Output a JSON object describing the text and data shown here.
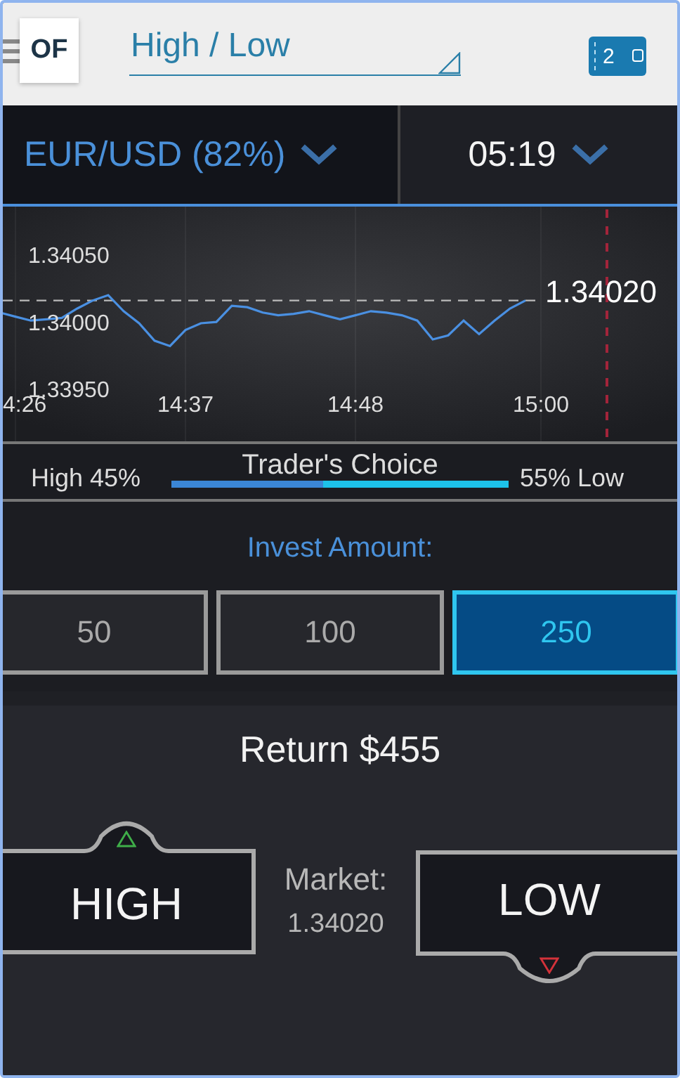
{
  "header": {
    "logo": "OF",
    "title": "High / Low",
    "wallet_count": "2"
  },
  "asset_selector": {
    "label": "EUR/USD (82%)"
  },
  "expiry_selector": {
    "label": "05:19"
  },
  "chart": {
    "chart_data": {
      "type": "line",
      "categories": [
        null,
        "4:26",
        null,
        null,
        null,
        null,
        null,
        null,
        null,
        null,
        null,
        null,
        "14:37",
        null,
        null,
        null,
        null,
        null,
        null,
        null,
        null,
        null,
        null,
        "14:48",
        null,
        null,
        null,
        null,
        null,
        null,
        null,
        null,
        null,
        null,
        null,
        "15:00",
        null,
        null,
        null,
        null,
        null,
        null,
        null,
        null,
        null
      ],
      "series": [
        {
          "color": "#4a90e2",
          "values": [
            1.34011,
            1.34008,
            1.34005,
            1.34006,
            1.34007,
            1.34014,
            1.3402,
            1.34024,
            1.34012,
            1.34003,
            1.3399,
            1.33986,
            1.33998,
            1.34003,
            1.34004,
            1.34016,
            1.34015,
            1.34011,
            1.34009,
            1.3401,
            1.34012,
            1.34009,
            1.34006,
            1.34009,
            1.34012,
            1.34011,
            1.34009,
            1.34005,
            1.33991,
            1.33994,
            1.34005,
            1.33995,
            1.34005,
            1.34014,
            1.3402,
            null,
            null,
            null,
            null,
            null,
            null,
            null,
            null,
            null,
            null
          ]
        }
      ],
      "ylim": [
        1.33915,
        1.3409
      ],
      "yticks": [
        {
          "value": 1.3405,
          "label": "1.34050"
        },
        {
          "value": 1.34,
          "label": "1.34000"
        },
        {
          "value": 1.3395,
          "label": "1.33950"
        }
      ],
      "grid": true,
      "ref_lines": [
        {
          "axis": "y",
          "value": 1.3402,
          "label": "1.34020"
        }
      ]
    }
  },
  "sentiment": {
    "title": "Trader's Choice",
    "high_label": "High 45%",
    "low_label": "55% Low",
    "level": 0.45
  },
  "invest": {
    "label": "Invest Amount:",
    "options": [
      {
        "label": "50",
        "selected": false
      },
      {
        "label": "100",
        "selected": false
      },
      {
        "label": "250",
        "selected": true
      }
    ]
  },
  "return_label": "Return $455",
  "trade": {
    "high": "HIGH",
    "market_label": "Market:",
    "market_value": "1.34020",
    "low": "LOW"
  }
}
